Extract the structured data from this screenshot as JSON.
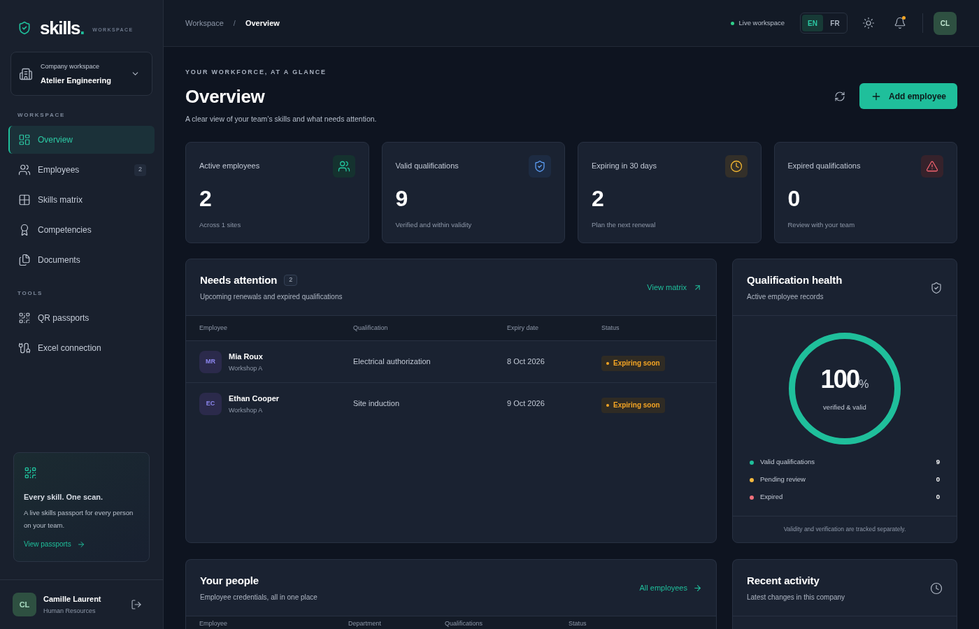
{
  "sidebar": {
    "logo": {
      "wordmark": "skills",
      "dot": ".",
      "tag": "WORKSPACE"
    },
    "workspace_switcher": {
      "label": "Company workspace",
      "value": "Atelier Engineering"
    },
    "sections": [
      {
        "title": "WORKSPACE",
        "items": [
          {
            "label": "Overview",
            "selected": true
          },
          {
            "label": "Employees",
            "selected": false,
            "badge": "2"
          },
          {
            "label": "Skills matrix",
            "selected": false
          },
          {
            "label": "Competencies",
            "selected": false
          },
          {
            "label": "Documents",
            "selected": false
          }
        ]
      },
      {
        "title": "TOOLS",
        "items": [
          {
            "label": "QR passports",
            "selected": false
          },
          {
            "label": "Excel connection",
            "selected": false
          }
        ]
      }
    ],
    "promo": {
      "title": "Every skill. One scan.",
      "text": "A live skills passport for every person on your team.",
      "link": "View passports"
    },
    "user": {
      "initials": "CL",
      "name": "Camille Laurent",
      "role": "Human Resources"
    }
  },
  "header": {
    "breadcrumbs": [
      {
        "label": "Workspace",
        "selected": false
      },
      {
        "label": "Overview",
        "selected": true
      }
    ],
    "separator": "/",
    "status": "Live workspace",
    "languages": [
      {
        "label": "EN",
        "selected": true
      },
      {
        "label": "FR",
        "selected": false
      }
    ],
    "notifications_unread": true,
    "avatar": "CL"
  },
  "page": {
    "eyebrow": "YOUR WORKFORCE, AT A GLANCE",
    "title": "Overview",
    "subtitle": "A clear view of your team’s skills and what needs attention.",
    "primary_action": "Add employee"
  },
  "stats": [
    {
      "kind": "employees",
      "label": "Active employees",
      "value": "2",
      "note": "Across 1 sites"
    },
    {
      "kind": "valid",
      "label": "Valid qualifications",
      "value": "9",
      "note": "Verified and within validity"
    },
    {
      "kind": "expiring",
      "label": "Expiring in 30 days",
      "value": "2",
      "note": "Plan the next renewal"
    },
    {
      "kind": "expired",
      "label": "Expired qualifications",
      "value": "0",
      "note": "Review with your team"
    }
  ],
  "needs_attention": {
    "title": "Needs attention",
    "count": "2",
    "subtitle": "Upcoming renewals and expired qualifications",
    "link": "View matrix",
    "columns": [
      "Employee",
      "Qualification",
      "Expiry date",
      "Status"
    ],
    "rows": [
      {
        "initials": "MR",
        "name": "Mia Roux",
        "site": "Workshop A",
        "qualification": "Electrical authorization",
        "expiry": "8 Oct 2026",
        "status": {
          "kind": "expiring",
          "label": "Expiring soon"
        }
      },
      {
        "initials": "EC",
        "name": "Ethan Cooper",
        "site": "Workshop A",
        "qualification": "Site induction",
        "expiry": "9 Oct 2026",
        "status": {
          "kind": "expiring",
          "label": "Expiring soon"
        }
      }
    ]
  },
  "qualification_health": {
    "title": "Qualification health",
    "subtitle": "Active employee records",
    "gauge": {
      "level": 1,
      "value": "100",
      "unit": "%",
      "caption": "verified & valid"
    },
    "legend": [
      {
        "label": "Valid qualifications",
        "value": "9",
        "color": "#1fbf9b"
      },
      {
        "label": "Pending review",
        "value": "0",
        "color": "#f5b93f"
      },
      {
        "label": "Expired",
        "value": "0",
        "color": "#f0707c"
      }
    ],
    "note": "Validity and verification are tracked separately."
  },
  "your_people": {
    "title": "Your people",
    "subtitle": "Employee credentials, all in one place",
    "link": "All employees",
    "columns": [
      "Employee",
      "Department",
      "Qualifications",
      "Status"
    ]
  },
  "recent_activity": {
    "title": "Recent activity",
    "subtitle": "Latest changes in this company"
  }
}
